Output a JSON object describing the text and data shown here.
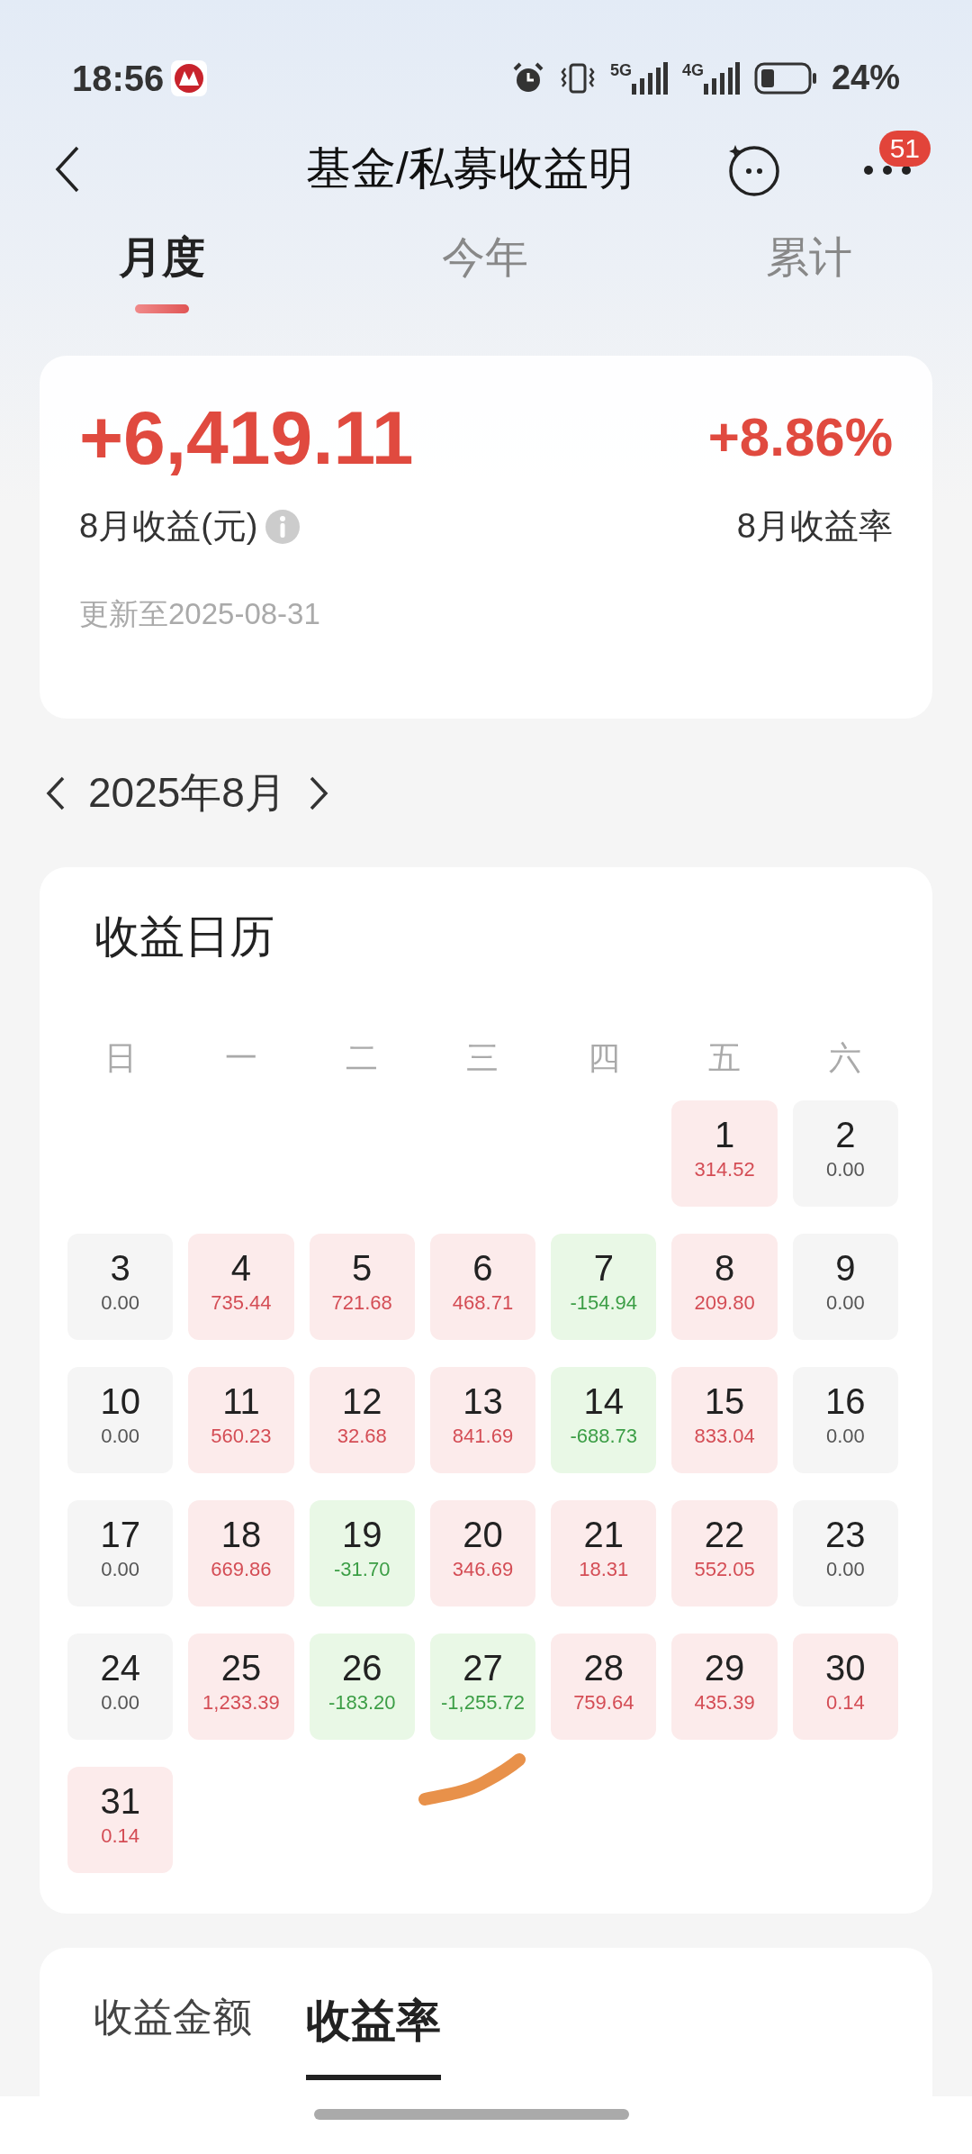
{
  "status_bar": {
    "time": "18:56",
    "network_1": "5G",
    "network_2": "4G",
    "battery": "24%"
  },
  "header": {
    "title": "基金/私募收益明",
    "badge": "51"
  },
  "tabs": [
    {
      "label": "月度",
      "selected": true
    },
    {
      "label": "今年",
      "selected": false
    },
    {
      "label": "累计",
      "selected": false
    }
  ],
  "summary": {
    "amount": "+6,419.11",
    "amount_label": "8月收益(元)",
    "rate": "+8.86%",
    "rate_label": "8月收益率",
    "updated": "更新至2025-08-31"
  },
  "month_nav": {
    "label": "2025年8月"
  },
  "calendar": {
    "title": "收益日历",
    "weekdays": [
      "日",
      "一",
      "二",
      "三",
      "四",
      "五",
      "六"
    ],
    "weeks": [
      [
        {
          "kind": "blank"
        },
        {
          "kind": "blank"
        },
        {
          "kind": "blank"
        },
        {
          "kind": "blank"
        },
        {
          "kind": "blank"
        },
        {
          "day": "1",
          "value": "314.52",
          "kind": "gain"
        },
        {
          "day": "2",
          "value": "0.00",
          "kind": "flat"
        }
      ],
      [
        {
          "day": "3",
          "value": "0.00",
          "kind": "flat"
        },
        {
          "day": "4",
          "value": "735.44",
          "kind": "gain"
        },
        {
          "day": "5",
          "value": "721.68",
          "kind": "gain"
        },
        {
          "day": "6",
          "value": "468.71",
          "kind": "gain"
        },
        {
          "day": "7",
          "value": "-154.94",
          "kind": "loss"
        },
        {
          "day": "8",
          "value": "209.80",
          "kind": "gain"
        },
        {
          "day": "9",
          "value": "0.00",
          "kind": "flat"
        }
      ],
      [
        {
          "day": "10",
          "value": "0.00",
          "kind": "flat"
        },
        {
          "day": "11",
          "value": "560.23",
          "kind": "gain"
        },
        {
          "day": "12",
          "value": "32.68",
          "kind": "gain"
        },
        {
          "day": "13",
          "value": "841.69",
          "kind": "gain"
        },
        {
          "day": "14",
          "value": "-688.73",
          "kind": "loss"
        },
        {
          "day": "15",
          "value": "833.04",
          "kind": "gain"
        },
        {
          "day": "16",
          "value": "0.00",
          "kind": "flat"
        }
      ],
      [
        {
          "day": "17",
          "value": "0.00",
          "kind": "flat"
        },
        {
          "day": "18",
          "value": "669.86",
          "kind": "gain"
        },
        {
          "day": "19",
          "value": "-31.70",
          "kind": "loss"
        },
        {
          "day": "20",
          "value": "346.69",
          "kind": "gain"
        },
        {
          "day": "21",
          "value": "18.31",
          "kind": "gain"
        },
        {
          "day": "22",
          "value": "552.05",
          "kind": "gain"
        },
        {
          "day": "23",
          "value": "0.00",
          "kind": "flat"
        }
      ],
      [
        {
          "day": "24",
          "value": "0.00",
          "kind": "flat"
        },
        {
          "day": "25",
          "value": "1,233.39",
          "kind": "gain"
        },
        {
          "day": "26",
          "value": "-183.20",
          "kind": "loss"
        },
        {
          "day": "27",
          "value": "-1,255.72",
          "kind": "loss"
        },
        {
          "day": "28",
          "value": "759.64",
          "kind": "gain"
        },
        {
          "day": "29",
          "value": "435.39",
          "kind": "gain"
        },
        {
          "day": "30",
          "value": "0.14",
          "kind": "gain"
        }
      ],
      [
        {
          "day": "31",
          "value": "0.14",
          "kind": "gain"
        }
      ]
    ]
  },
  "bottom_tabs": [
    {
      "label": "收益金额",
      "selected": false
    },
    {
      "label": "收益率",
      "selected": true
    }
  ]
}
